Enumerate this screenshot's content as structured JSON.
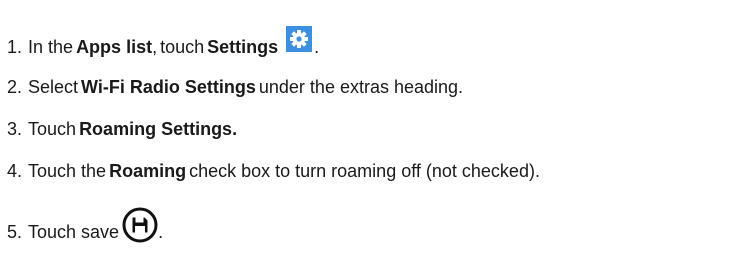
{
  "steps": [
    {
      "number": "1.",
      "parts": [
        "In the",
        "Apps list",
        ",",
        "touch",
        "Settings",
        "."
      ],
      "icon": "settings-gear-icon",
      "icon_color": "#3d8fe0"
    },
    {
      "number": "2.",
      "parts": [
        "Select",
        "Wi-Fi Radio Settings",
        "under the extras heading."
      ]
    },
    {
      "number": "3.",
      "parts": [
        "Touch",
        "Roaming Settings."
      ]
    },
    {
      "number": "4.",
      "parts": [
        "Touch the",
        "Roaming",
        "check box to turn roaming off (not checked)."
      ]
    },
    {
      "number": "5.",
      "parts": [
        "Touch save",
        "."
      ],
      "icon": "save-floppy-icon"
    }
  ]
}
